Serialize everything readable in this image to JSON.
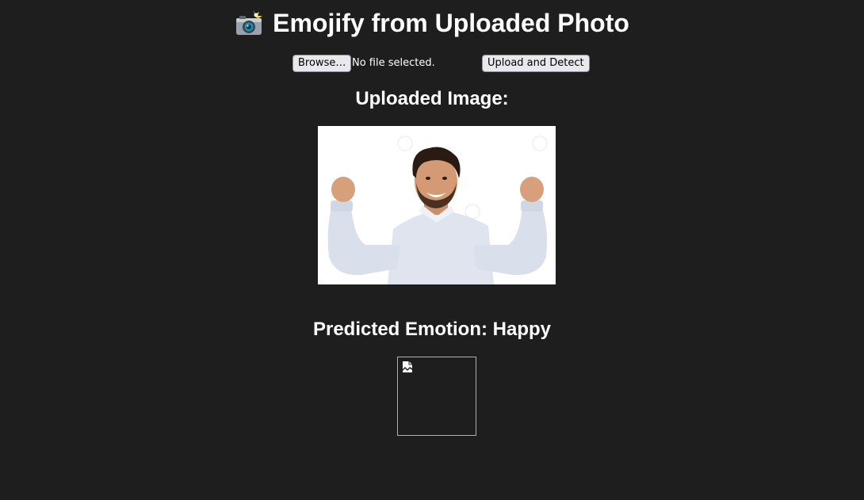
{
  "page": {
    "title": "Emojify from Uploaded Photo",
    "title_icon": "camera-with-flash-icon"
  },
  "upload": {
    "browse_label": "Browse…",
    "file_status": "No file selected.",
    "submit_label": "Upload and Detect"
  },
  "uploaded_section": {
    "heading": "Uploaded Image:"
  },
  "prediction": {
    "heading": "Predicted Emotion: Happy"
  },
  "emoji_image": {
    "icon": "broken-image-icon"
  },
  "colors": {
    "background": "#1e1e1e",
    "text": "#ffffff",
    "button_bg": "#e9e9ed"
  }
}
